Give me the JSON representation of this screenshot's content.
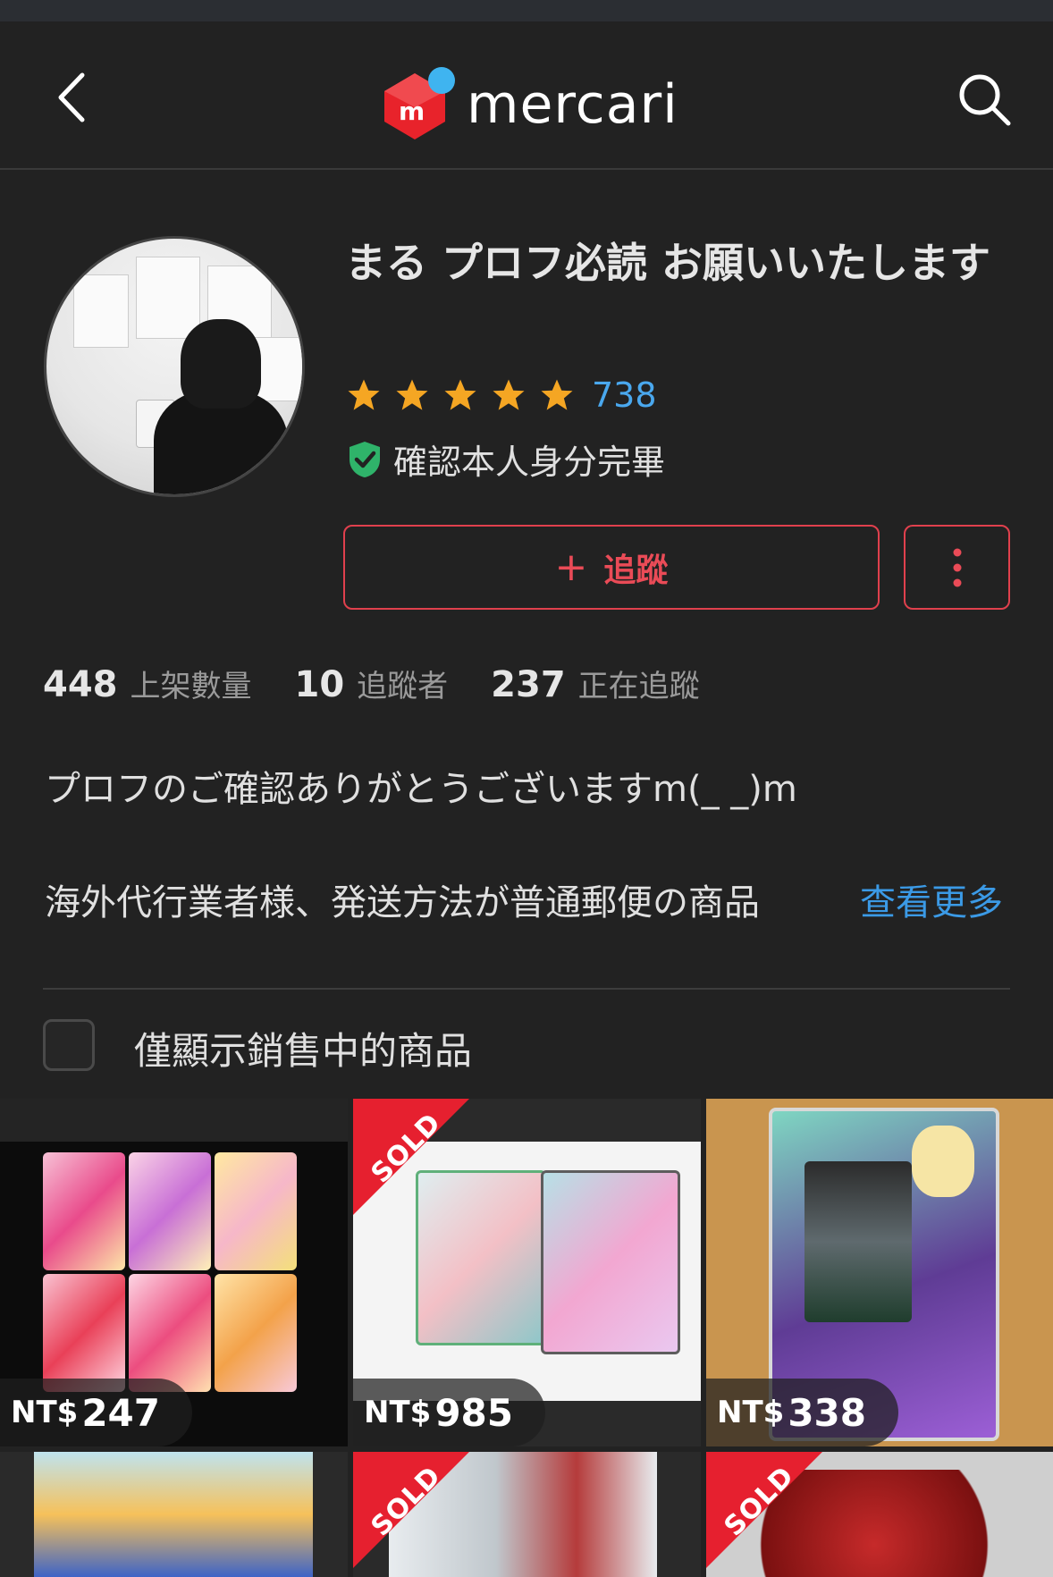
{
  "header": {
    "logo_text": "mercari",
    "logo_badge": "m"
  },
  "profile": {
    "name": "まる プロフ必読 お願いいたします",
    "rating_stars": 5,
    "rating_count": "738",
    "verified_text": "確認本人身分完畢",
    "follow_label": "追蹤",
    "follow_icon": "+"
  },
  "stats": [
    {
      "value": "448",
      "label": "上架數量"
    },
    {
      "value": "10",
      "label": "追蹤者"
    },
    {
      "value": "237",
      "label": "正在追蹤"
    }
  ],
  "bio": {
    "line1": "プロフのご確認ありがとうございますm(_ _)m",
    "line2": "海外代行業者様、発送方法が普通郵便の商品",
    "see_more": "查看更多"
  },
  "filter": {
    "checkbox_label": "僅顯示銷售中的商品",
    "checked": false
  },
  "items": [
    {
      "sold": false,
      "currency": "NT$",
      "price": "247"
    },
    {
      "sold": true,
      "sold_label": "SOLD",
      "currency": "NT$",
      "price": "985"
    },
    {
      "sold": false,
      "currency": "NT$",
      "price": "338"
    },
    {
      "sold": false
    },
    {
      "sold": true,
      "sold_label": "SOLD"
    },
    {
      "sold": true,
      "sold_label": "SOLD"
    }
  ],
  "colors": {
    "accent_red": "#e0404d",
    "link_blue": "#3b9ae6",
    "star_gold": "#f5a623",
    "verify_green": "#2fb36a",
    "background": "#222222"
  },
  "icons": [
    "back-arrow-icon",
    "search-icon",
    "star-icon",
    "shield-check-icon",
    "plus-icon",
    "more-vertical-icon",
    "checkbox-icon"
  ]
}
